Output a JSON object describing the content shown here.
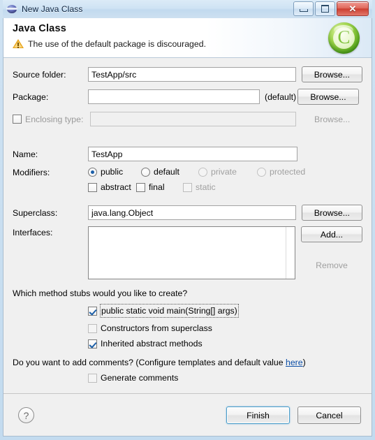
{
  "window": {
    "title": "New Java Class",
    "icon": "eclipse-sphere-icon",
    "controls": {
      "minimize": "—",
      "maximize": "□",
      "close": "✕"
    }
  },
  "header": {
    "title": "Java Class",
    "message": "The use of the default package is discouraged.",
    "message_icon": "warning-triangle-icon",
    "page_icon": "java-class-green-c-icon",
    "page_icon_letter": "C"
  },
  "form": {
    "source_folder": {
      "label": "Source folder:",
      "value": "TestApp/src",
      "browse": "Browse...",
      "enabled": true
    },
    "package": {
      "label": "Package:",
      "value": "",
      "suffix": "(default)",
      "browse": "Browse...",
      "enabled": true
    },
    "enclosing_type": {
      "label": "Enclosing type:",
      "value": "",
      "checked": false,
      "browse": "Browse...",
      "enabled": false
    },
    "name": {
      "label": "Name:",
      "value": "TestApp"
    },
    "modifiers": {
      "label": "Modifiers:",
      "radios": [
        {
          "label": "public",
          "selected": true,
          "enabled": true
        },
        {
          "label": "default",
          "selected": false,
          "enabled": true
        },
        {
          "label": "private",
          "selected": false,
          "enabled": false
        },
        {
          "label": "protected",
          "selected": false,
          "enabled": false
        }
      ],
      "checkboxes": [
        {
          "label": "abstract",
          "checked": false,
          "enabled": true
        },
        {
          "label": "final",
          "checked": false,
          "enabled": true
        },
        {
          "label": "static",
          "checked": false,
          "enabled": false
        }
      ]
    },
    "superclass": {
      "label": "Superclass:",
      "value": "java.lang.Object",
      "browse": "Browse..."
    },
    "interfaces": {
      "label": "Interfaces:",
      "items": [],
      "add": "Add...",
      "remove": "Remove",
      "remove_enabled": false
    }
  },
  "stubs": {
    "question": "Which method stubs would you like to create?",
    "options": [
      {
        "label": "public static void main(String[] args)",
        "checked": true,
        "focused": true,
        "enabled": true
      },
      {
        "label": "Constructors from superclass",
        "checked": false,
        "focused": false,
        "enabled": true
      },
      {
        "label": "Inherited abstract methods",
        "checked": true,
        "focused": false,
        "enabled": true
      }
    ]
  },
  "comments": {
    "question_before": "Do you want to add comments? (Configure templates and default value ",
    "link": "here",
    "question_after": ")",
    "checkbox": {
      "label": "Generate comments",
      "checked": false
    }
  },
  "footer": {
    "help": "?",
    "finish": "Finish",
    "cancel": "Cancel"
  }
}
